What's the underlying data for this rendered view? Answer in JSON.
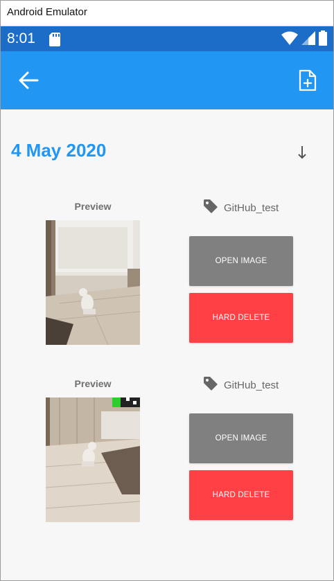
{
  "window": {
    "title": "Android Emulator"
  },
  "status_bar": {
    "time": "8:01",
    "icons": [
      "sd-card-icon",
      "wifi-icon",
      "signal-icon",
      "battery-icon"
    ]
  },
  "app_bar": {
    "back_icon": "arrow-left-icon",
    "action_icon": "new-file-icon"
  },
  "section": {
    "date": "4 May 2020",
    "sort_icon": "arrow-down-icon"
  },
  "items": [
    {
      "preview_label": "Preview",
      "tag": "GitHub_test",
      "open_label": "OPEN IMAGE",
      "delete_label": "HARD DELETE"
    },
    {
      "preview_label": "Preview",
      "tag": "GitHub_test",
      "open_label": "OPEN IMAGE",
      "delete_label": "HARD DELETE"
    }
  ],
  "colors": {
    "primary": "#2196f3",
    "status": "#1b6dc7",
    "open": "#808080",
    "delete": "#ff4045"
  }
}
